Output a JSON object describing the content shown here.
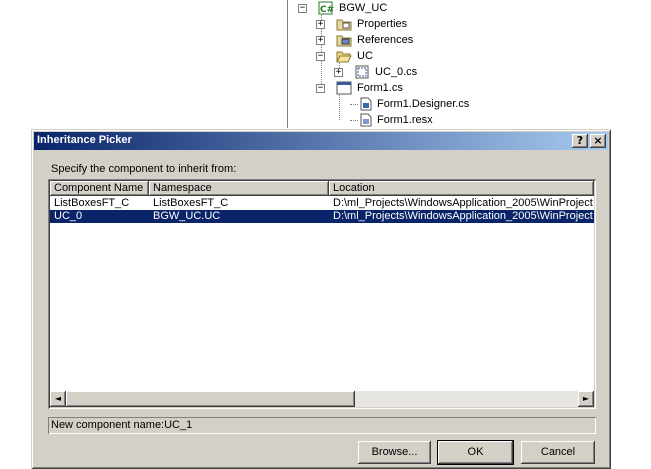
{
  "tree": {
    "items": [
      {
        "label": "BGW_UC",
        "expander": "−",
        "icon": "csharp-project-icon"
      },
      {
        "label": "Properties",
        "expander": "+",
        "icon": "properties-folder-icon"
      },
      {
        "label": "References",
        "expander": "+",
        "icon": "references-folder-icon"
      },
      {
        "label": "UC",
        "expander": "−",
        "icon": "folder-open-icon"
      },
      {
        "label": "UC_0.cs",
        "expander": "+",
        "icon": "user-control-file-icon"
      },
      {
        "label": "Form1.cs",
        "expander": "−",
        "icon": "form-file-icon"
      },
      {
        "label": "Form1.Designer.cs",
        "expander": "",
        "icon": "cs-file-icon"
      },
      {
        "label": "Form1.resx",
        "expander": "",
        "icon": "resx-file-icon"
      }
    ]
  },
  "dialog": {
    "title": "Inheritance Picker",
    "help_glyph": "?",
    "close_glyph": "×",
    "instruction": "Specify the component to inherit from:",
    "columns": [
      "Component Name",
      "Namespace",
      "Location"
    ],
    "rows": [
      {
        "name": "ListBoxesFT_C",
        "namespace": "ListBoxesFT_C",
        "location": "D:\\ml_Projects\\WindowsApplication_2005\\WinProject",
        "selected": false
      },
      {
        "name": "UC_0",
        "namespace": "BGW_UC.UC",
        "location": "D:\\ml_Projects\\WindowsApplication_2005\\WinProject",
        "selected": true
      }
    ],
    "scroll_left": "◄",
    "scroll_right": "►",
    "new_component_name": "New component name:UC_1",
    "buttons": {
      "browse": "Browse...",
      "ok": "OK",
      "cancel": "Cancel"
    }
  },
  "colors": {
    "selection": "#0a246a",
    "title_start": "#0a246a",
    "title_end": "#a6caf0",
    "face": "#d4d0c8"
  }
}
